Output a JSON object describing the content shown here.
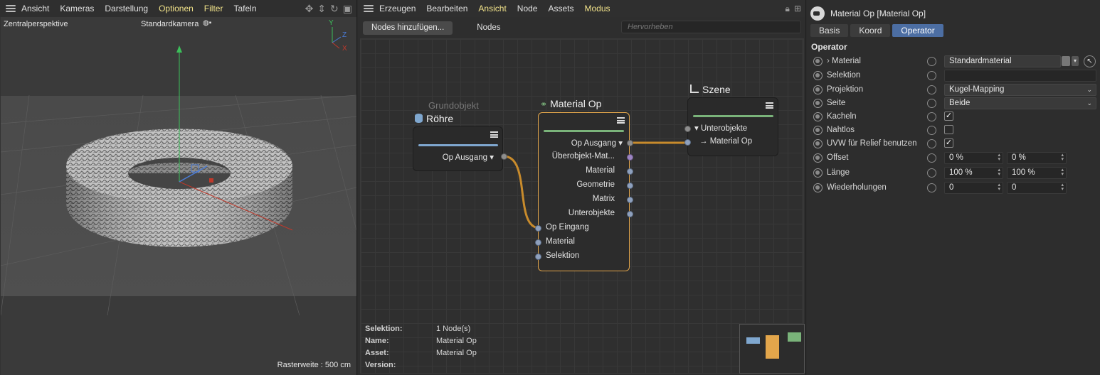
{
  "viewport": {
    "menu": [
      "Ansicht",
      "Kameras",
      "Darstellung",
      "Optionen",
      "Filter",
      "Tafeln"
    ],
    "highlighted_menu": [
      "Optionen",
      "Filter"
    ],
    "projection": "Zentralperspektive",
    "camera": "Standardkamera",
    "camera_icon": "camera-icon",
    "axis_labels": {
      "y": "Y",
      "z": "Z",
      "x": "X"
    },
    "grid_spacing": "Rasterweite : 500 cm"
  },
  "node_editor": {
    "menu": [
      "Erzeugen",
      "Bearbeiten",
      "Ansicht",
      "Node",
      "Assets",
      "Modus"
    ],
    "highlighted_menu": [
      "Ansicht",
      "Modus"
    ],
    "add_button": "Nodes hinzufügen...",
    "tab": "Nodes",
    "search_placeholder": "Hervorheben",
    "nodes": {
      "roehre": {
        "subtitle": "Grundobjekt",
        "title": "Röhre",
        "bar_color": "#7fa7cf",
        "outputs": [
          "Op Ausgang"
        ]
      },
      "material_op": {
        "title": "Material Op",
        "bar_color": "#7ab37a",
        "outputs": [
          "Op Ausgang",
          "Überobjekt-Mat...",
          "Material",
          "Geometrie",
          "Matrix",
          "Unterobjekte"
        ],
        "inputs": [
          "Op Eingang",
          "Material",
          "Selektion"
        ]
      },
      "szene": {
        "title": "Szene",
        "bar_color": "#7ab37a",
        "ports": [
          "Unterobjekte",
          "Material Op"
        ]
      }
    },
    "wire_color": "#c88b2c",
    "info": [
      {
        "key": "Selektion:",
        "value": "1 Node(s)"
      },
      {
        "key": "Name:",
        "value": "Material Op"
      },
      {
        "key": "Asset:",
        "value": "Material Op"
      },
      {
        "key": "Version:",
        "value": ""
      }
    ]
  },
  "attributes": {
    "title": "Material Op [Material Op]",
    "tabs": [
      "Basis",
      "Koord",
      "Operator"
    ],
    "active_tab": "Operator",
    "section": "Operator",
    "rows": {
      "material": {
        "label": "Material",
        "value": "Standardmaterial"
      },
      "selektion": {
        "label": "Selektion",
        "value": ""
      },
      "projektion": {
        "label": "Projektion",
        "value": "Kugel-Mapping"
      },
      "seite": {
        "label": "Seite",
        "value": "Beide"
      },
      "kacheln": {
        "label": "Kacheln",
        "checked": "✓"
      },
      "nahtlos": {
        "label": "Nahtlos",
        "checked": ""
      },
      "uvw": {
        "label": "UVW für Relief benutzen",
        "checked": "✓"
      },
      "offset": {
        "label": "Offset",
        "v1": "0 %",
        "v2": "0 %"
      },
      "laenge": {
        "label": "Länge",
        "v1": "100 %",
        "v2": "100 %"
      },
      "wiederholungen": {
        "label": "Wiederholungen",
        "v1": "0",
        "v2": "0"
      }
    }
  }
}
